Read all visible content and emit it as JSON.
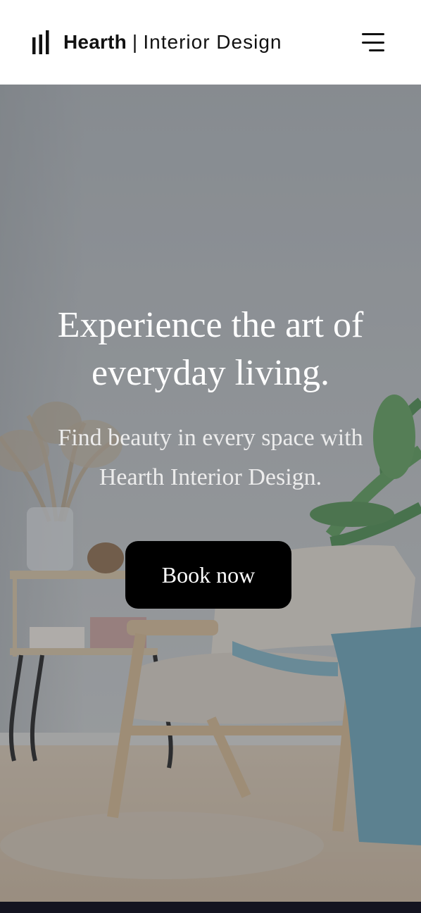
{
  "header": {
    "brand_name": "Hearth",
    "brand_separator": "|",
    "brand_subtitle": "Interior Design",
    "logo_icon": "bars-logo-icon",
    "menu_icon": "hamburger-menu-icon"
  },
  "hero": {
    "title": "Experience the art of everyday living.",
    "subtitle": "Find beauty in every space with Hearth Interior Design.",
    "cta_label": "Book now"
  },
  "colors": {
    "header_bg": "#ffffff",
    "text_dark": "#111111",
    "cta_bg": "#000000",
    "cta_text": "#ffffff",
    "hero_text": "#ffffff",
    "footer_strip": "#141420"
  }
}
